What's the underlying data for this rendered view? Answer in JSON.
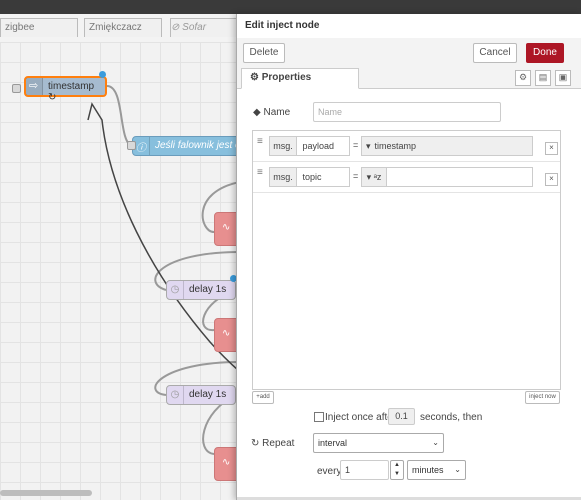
{
  "workspace": {
    "tabs": [
      "zigbee",
      "Zmiękczacz",
      "Sofar"
    ]
  },
  "canvas": {
    "inject_node_label": "timestamp ↻",
    "comment_node_label": "Jeśli falownik jest onli",
    "delay_nodes": [
      "delay 1s",
      "delay 1s"
    ]
  },
  "tray": {
    "title": "Edit inject node",
    "delete_label": "Delete",
    "cancel_label": "Cancel",
    "done_label": "Done",
    "properties_tab": "Properties",
    "name_label": "Name",
    "name_placeholder": "Name",
    "rows": [
      {
        "prefix": "msg.",
        "property": "payload",
        "eq": "=",
        "value": "timestamp"
      },
      {
        "prefix": "msg.",
        "property": "topic",
        "eq": "=",
        "value": ""
      }
    ],
    "add_label": "add",
    "inject_now_label": "inject now",
    "inject_once_label": "Inject once after",
    "inject_once_value": "0.1",
    "inject_once_suffix": "seconds, then",
    "repeat_label": "Repeat",
    "repeat_value": "interval",
    "every_label": "every",
    "every_value": "1",
    "units_value": "minutes"
  },
  "colors": {
    "done_button": "#ad1625",
    "inject_node": "#a6bbcf",
    "comment_node": "#87bfdd",
    "selected_outline": "#ff7f0e"
  }
}
